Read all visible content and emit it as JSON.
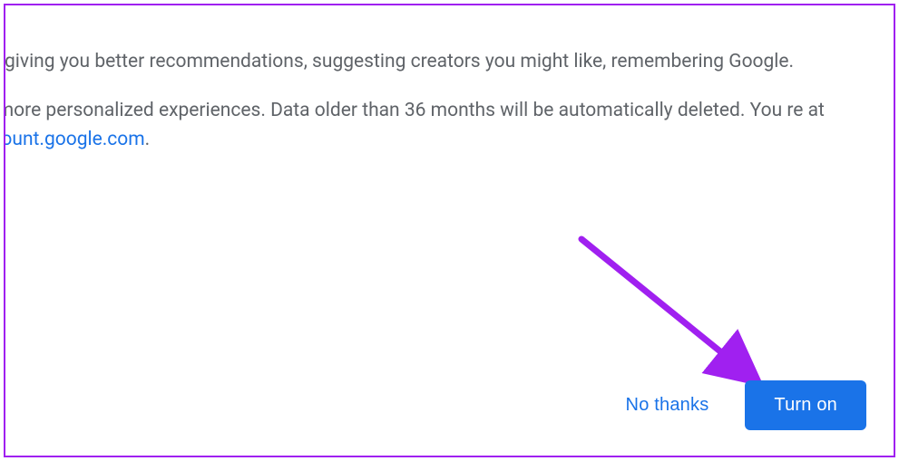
{
  "body": {
    "paragraph1_fragment": "like giving you better recommendations, suggesting creators you might like, remembering Google.",
    "paragraph2_prefix": "ou more personalized experiences. Data older than 36 months will be automatically deleted. You re at ",
    "link_text": "account.google.com",
    "paragraph2_suffix": "."
  },
  "actions": {
    "secondary": "No thanks",
    "primary": "Turn on"
  },
  "annotation": {
    "arrow_color": "#a020f0"
  }
}
